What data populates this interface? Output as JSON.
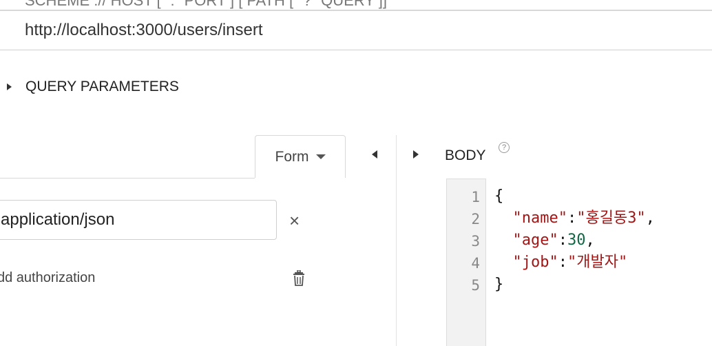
{
  "request": {
    "url_template_hint": "SCHEME :// HOST [ \":\" PORT ] [ PATH [ \"?\" QUERY ]]",
    "url": "http://localhost:3000/users/insert",
    "query_parameters_label": "QUERY PARAMETERS"
  },
  "headers": {
    "form_tab_label": "Form",
    "header_value": "application/json",
    "remove_label": "×",
    "add_authorization_label": "dd authorization"
  },
  "body": {
    "label": "BODY",
    "help_label": "?",
    "line_numbers": [
      "1",
      "2",
      "3",
      "4",
      "5"
    ],
    "lines": [
      [
        "{"
      ],
      [
        "  ",
        "\"name\"",
        ":",
        "\"홍길동3\"",
        ","
      ],
      [
        "  ",
        "\"age\"",
        ":",
        "30",
        ","
      ],
      [
        "  ",
        "\"job\"",
        ":",
        "\"개발자\""
      ],
      [
        "}"
      ]
    ]
  },
  "colors": {
    "string": "#a31515",
    "number": "#116644",
    "border": "#d8d8d8"
  },
  "icons": [
    "expand-right-icon",
    "caret-down-icon",
    "close-icon",
    "trash-icon",
    "collapse-left-icon",
    "help-icon"
  ]
}
